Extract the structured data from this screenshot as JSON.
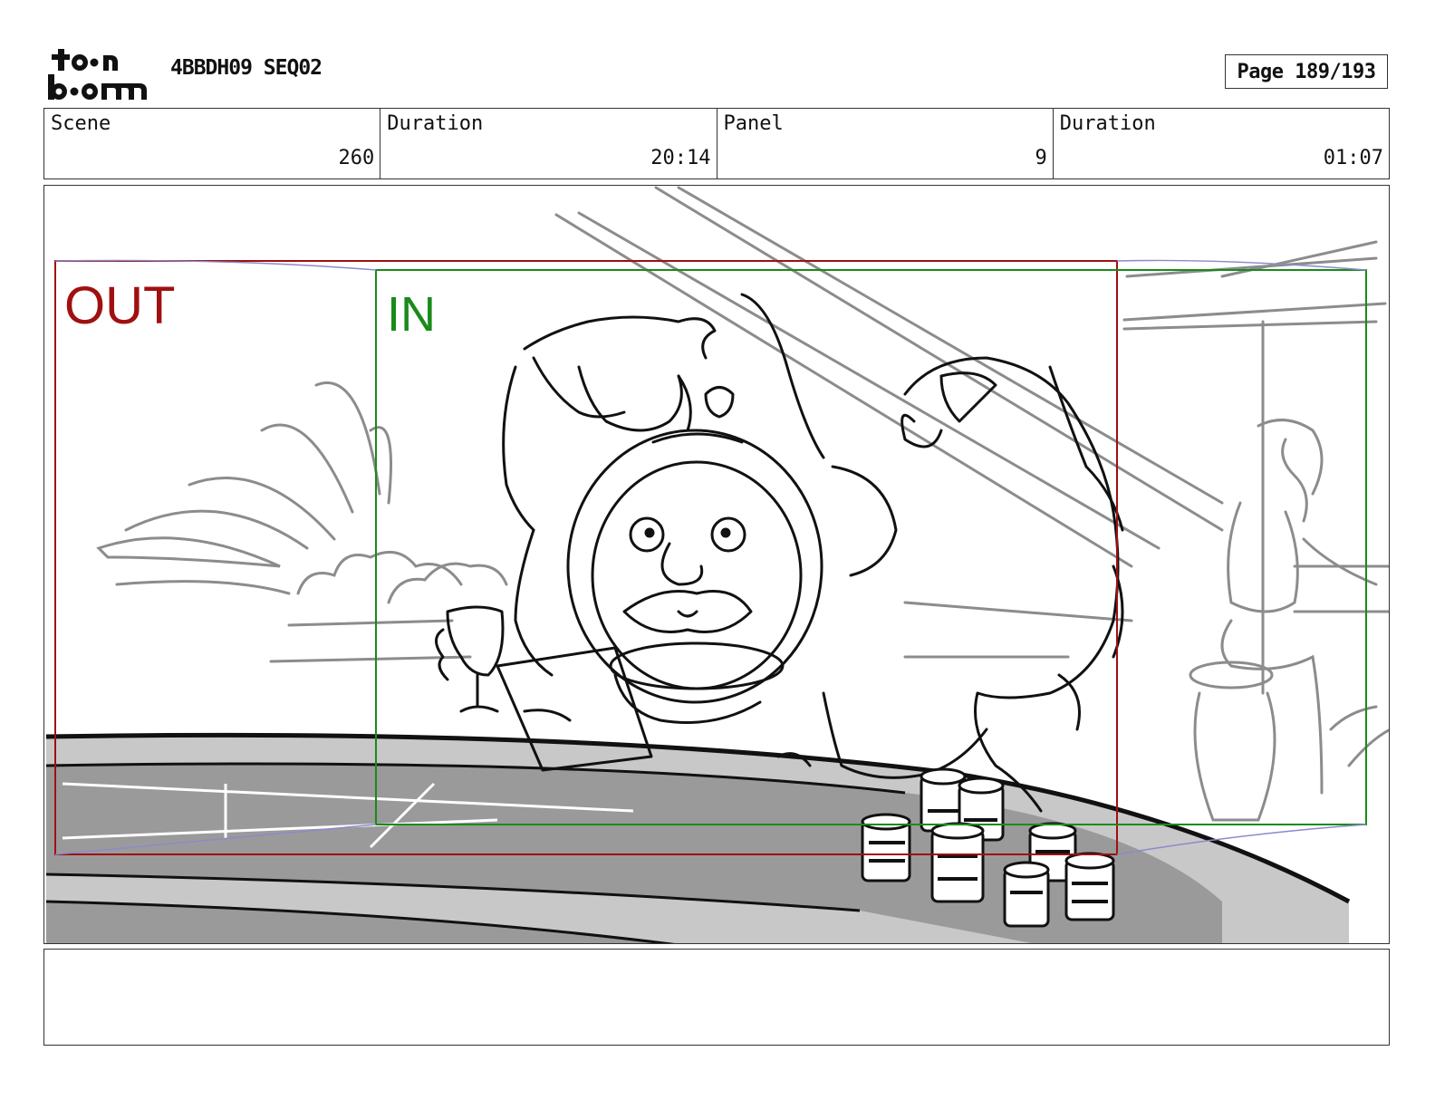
{
  "header": {
    "project_title": "4BBDH09 SEQ02",
    "page_label": "Page 189/193"
  },
  "info": {
    "scene_label": "Scene",
    "scene_value": "260",
    "scene_duration_label": "Duration",
    "scene_duration_value": "20:14",
    "panel_label": "Panel",
    "panel_value": "9",
    "panel_duration_label": "Duration",
    "panel_duration_value": "01:07"
  },
  "panel": {
    "out_label": "OUT",
    "in_label": "IN",
    "colors": {
      "out_frame": "#a01010",
      "in_frame": "#1a8a1a",
      "sketch_ink": "#111111",
      "background_ink": "#8c8c8c",
      "table_felt": "#9a9a9a",
      "table_rail": "#c8c8c8"
    }
  },
  "notes": {
    "text": ""
  },
  "logo": {
    "name": "toon-boom-logo"
  }
}
